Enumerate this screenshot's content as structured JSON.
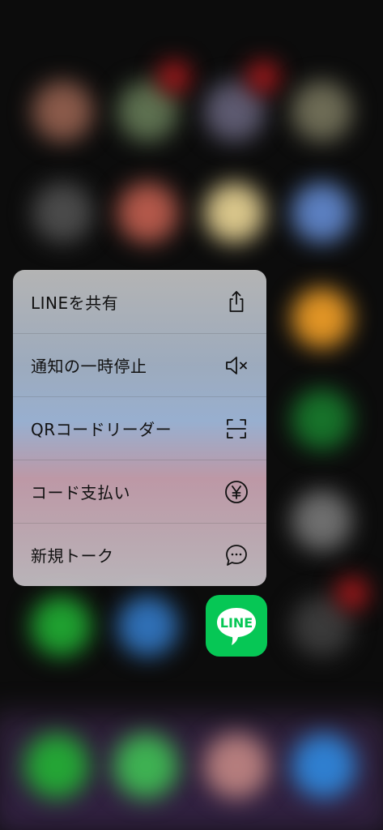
{
  "menu": {
    "items": [
      {
        "label": "LINEを共有",
        "icon": "share-icon"
      },
      {
        "label": "通知の一時停止",
        "icon": "speaker-mute-icon"
      },
      {
        "label": "QRコードリーダー",
        "icon": "qr-scan-icon"
      },
      {
        "label": "コード支払い",
        "icon": "yen-circle-icon"
      },
      {
        "label": "新規トーク",
        "icon": "chat-bubble-icon"
      }
    ]
  },
  "app": {
    "icon_text": "LINE",
    "color": "#06c755"
  }
}
